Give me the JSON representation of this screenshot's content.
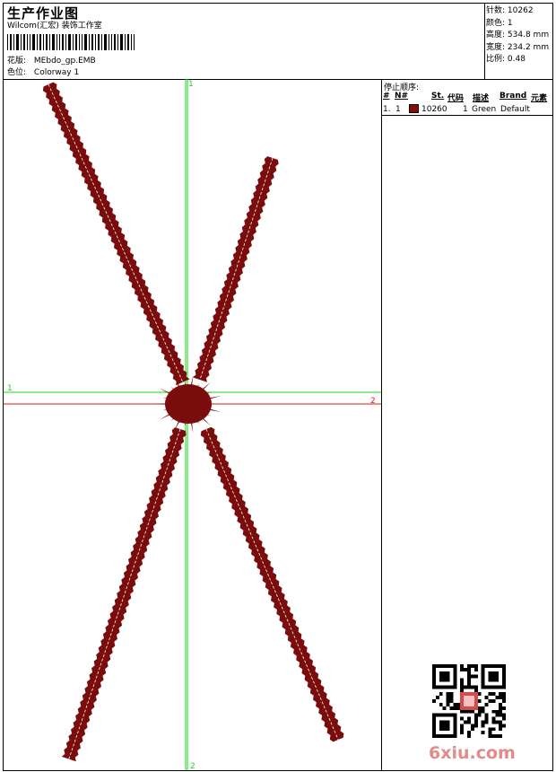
{
  "header": {
    "title": "生产作业图",
    "studio": "Wilcom(汇宏) 装饰工作室",
    "design_label": "花版:",
    "design_value": "MEbdo_gp.EMB",
    "colorway_label": "色位:",
    "colorway_value": "Colorway 1"
  },
  "stats": {
    "stitches_label": "针数:",
    "stitches_value": "10262",
    "colors_label": "颜色:",
    "colors_value": "1",
    "height_label": "高度:",
    "height_value": "534.8 mm",
    "width_label": "宽度:",
    "width_value": "234.2 mm",
    "scale_label": "比例:",
    "scale_value": "0.48"
  },
  "stop_sequence": {
    "title": "停止顺序:",
    "columns": [
      "#",
      "N#",
      "St.",
      "代码",
      "描述",
      "Brand",
      "元素"
    ],
    "rows": [
      {
        "index": "1.",
        "needle": "1",
        "color": "#8a0a0a",
        "stitches": "10260",
        "code": "1",
        "description": "Green",
        "brand": "Default",
        "element": ""
      }
    ]
  },
  "markers": {
    "green_top": "1",
    "green_left": "1",
    "red_right": "2",
    "green_bottom": "2"
  },
  "design": {
    "thread_color": "#7a0c0c",
    "axis_green": "#19d319",
    "axis_red": "#d02020"
  },
  "watermark": {
    "text": "6xiu.com"
  }
}
